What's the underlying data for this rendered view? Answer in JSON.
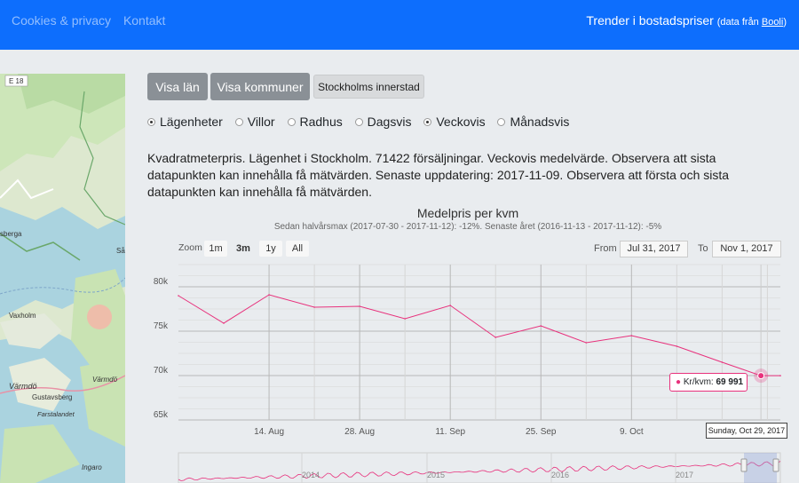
{
  "nav": {
    "links": [
      "Cookies & privacy",
      "Kontakt"
    ],
    "brand_title": "Trender i bostadspriser",
    "brand_note_prefix": "(data från ",
    "brand_note_link": "Booli",
    "brand_note_suffix": ")"
  },
  "map": {
    "labels": [
      "E 18",
      "sberga",
      "Vaxholm",
      "Värmdö",
      "Gustavsberg",
      "Farstalandet",
      "Värmdö",
      "Ingaro",
      "Så"
    ]
  },
  "buttons": {
    "lan": "Visa län",
    "kommuner": "Visa kommuner",
    "innerstad": "Stockholms innerstad"
  },
  "radios": [
    {
      "label": "Lägenheter",
      "checked": true
    },
    {
      "label": "Villor",
      "checked": false
    },
    {
      "label": "Radhus",
      "checked": false
    },
    {
      "label": "Dagsvis",
      "checked": false
    },
    {
      "label": "Veckovis",
      "checked": true
    },
    {
      "label": "Månadsvis",
      "checked": false
    }
  ],
  "description": "Kvadratmeterpris. Lägenhet i Stockholm. 71422 försäljningar. Veckovis medelvärde. Observera att sista datapunkten kan innehålla få mätvärden. Senaste uppdatering: 2017-11-09. Observera att första och sista datapunkten kan innehålla få mätvärden.",
  "chart_data": {
    "type": "line",
    "title": "Medelpris per kvm",
    "subtitle": "Sedan halvårsmax (2017-07-30 - 2017-11-12): -12%. Senaste året (2016-11-13 - 2017-11-12): -5%",
    "series": [
      {
        "name": "Kr/kvm",
        "color": "#e8317c",
        "points": [
          {
            "x": "2017-07-31",
            "y": 79000
          },
          {
            "x": "2017-08-07",
            "y": 75900
          },
          {
            "x": "2017-08-14",
            "y": 79100
          },
          {
            "x": "2017-08-21",
            "y": 77700
          },
          {
            "x": "2017-08-28",
            "y": 77800
          },
          {
            "x": "2017-09-04",
            "y": 76400
          },
          {
            "x": "2017-09-11",
            "y": 77900
          },
          {
            "x": "2017-09-18",
            "y": 74300
          },
          {
            "x": "2017-09-25",
            "y": 75600
          },
          {
            "x": "2017-10-02",
            "y": 73700
          },
          {
            "x": "2017-10-09",
            "y": 74500
          },
          {
            "x": "2017-10-16",
            "y": 73300
          },
          {
            "x": "2017-10-23",
            "y": 71500
          },
          {
            "x": "2017-10-29",
            "y": 69991
          },
          {
            "x": "2017-11-01",
            "y": 69991
          }
        ]
      }
    ],
    "y_ticks": [
      "65k",
      "70k",
      "75k",
      "80k"
    ],
    "x_ticks": [
      "14. Aug",
      "28. Aug",
      "11. Sep",
      "25. Sep",
      "9. Oct"
    ],
    "ylim": [
      65000,
      82500
    ],
    "xlim": [
      "2017-07-31",
      "2017-11-01"
    ],
    "grid": true,
    "zoom": {
      "label": "Zoom",
      "buttons": [
        "1m",
        "3m",
        "1y",
        "All"
      ],
      "active": "3m"
    },
    "range": {
      "from_label": "From",
      "from": "Jul 31, 2017",
      "to_label": "To",
      "to": "Nov 1, 2017"
    },
    "tooltip": {
      "series_label": "Kr/kvm:",
      "value": "69 991"
    },
    "crosshair_label": "Sunday, Oct 29, 2017",
    "navigator_labels": [
      "2014",
      "2015",
      "2016",
      "2017"
    ]
  }
}
